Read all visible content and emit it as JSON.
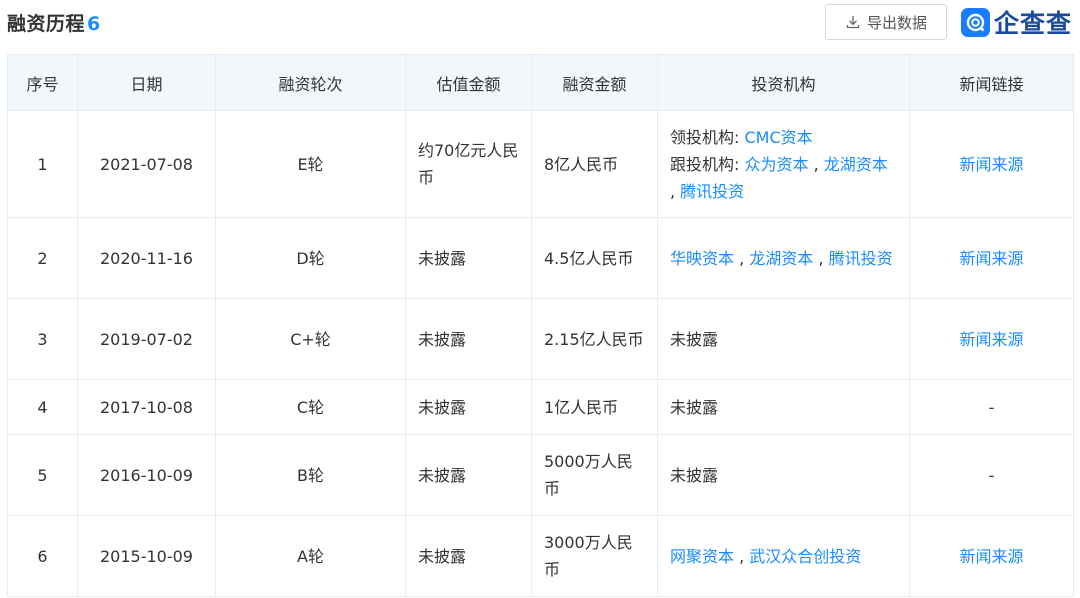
{
  "header": {
    "title": "融资历程",
    "count": "6",
    "export_label": "导出数据",
    "brand_name": "企查查"
  },
  "table": {
    "columns": [
      "序号",
      "日期",
      "融资轮次",
      "估值金额",
      "融资金额",
      "投资机构",
      "新闻链接"
    ],
    "rows": [
      {
        "index": "1",
        "date": "2021-07-08",
        "round": "E轮",
        "valuation": "约70亿元人民币",
        "amount": "8亿人民币",
        "lead_label": "领投机构: ",
        "lead": [
          "CMC资本"
        ],
        "follow_label": "跟投机构: ",
        "follow": [
          "众为资本",
          "龙湖资本",
          "腾讯投资"
        ],
        "news": "新闻来源"
      },
      {
        "index": "2",
        "date": "2020-11-16",
        "round": "D轮",
        "valuation": "未披露",
        "amount": "4.5亿人民币",
        "investors": [
          "华映资本",
          "龙湖资本",
          "腾讯投资"
        ],
        "news": "新闻来源"
      },
      {
        "index": "3",
        "date": "2019-07-02",
        "round": "C+轮",
        "valuation": "未披露",
        "amount": "2.15亿人民币",
        "investors_text": "未披露",
        "news": "新闻来源"
      },
      {
        "index": "4",
        "date": "2017-10-08",
        "round": "C轮",
        "valuation": "未披露",
        "amount": "1亿人民币",
        "investors_text": "未披露",
        "news": "-"
      },
      {
        "index": "5",
        "date": "2016-10-09",
        "round": "B轮",
        "valuation": "未披露",
        "amount": "5000万人民币",
        "investors_text": "未披露",
        "news": "-"
      },
      {
        "index": "6",
        "date": "2015-10-09",
        "round": "A轮",
        "valuation": "未披露",
        "amount": "3000万人民币",
        "investors": [
          "网聚资本",
          "武汉众合创投资"
        ],
        "news": "新闻来源"
      }
    ],
    "separator": " , "
  }
}
